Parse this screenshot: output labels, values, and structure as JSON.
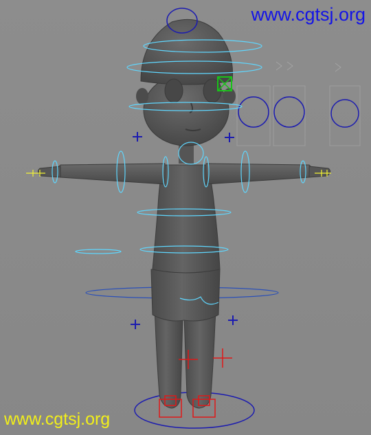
{
  "watermarks": {
    "top": "www.cgtsj.org",
    "bottom": "www.cgtsj.org"
  },
  "colors": {
    "background": "#8a8a8a",
    "mesh": "#585858",
    "mesh_shadow": "#3c3c3c",
    "rig_cyan": "#5fd7ff",
    "rig_blue": "#1b1bb0",
    "rig_red": "#e01818",
    "rig_green": "#19c219",
    "rig_yellow": "#f3f335",
    "watermark_top": "#1414e6",
    "watermark_bottom": "#f2ef1a"
  }
}
